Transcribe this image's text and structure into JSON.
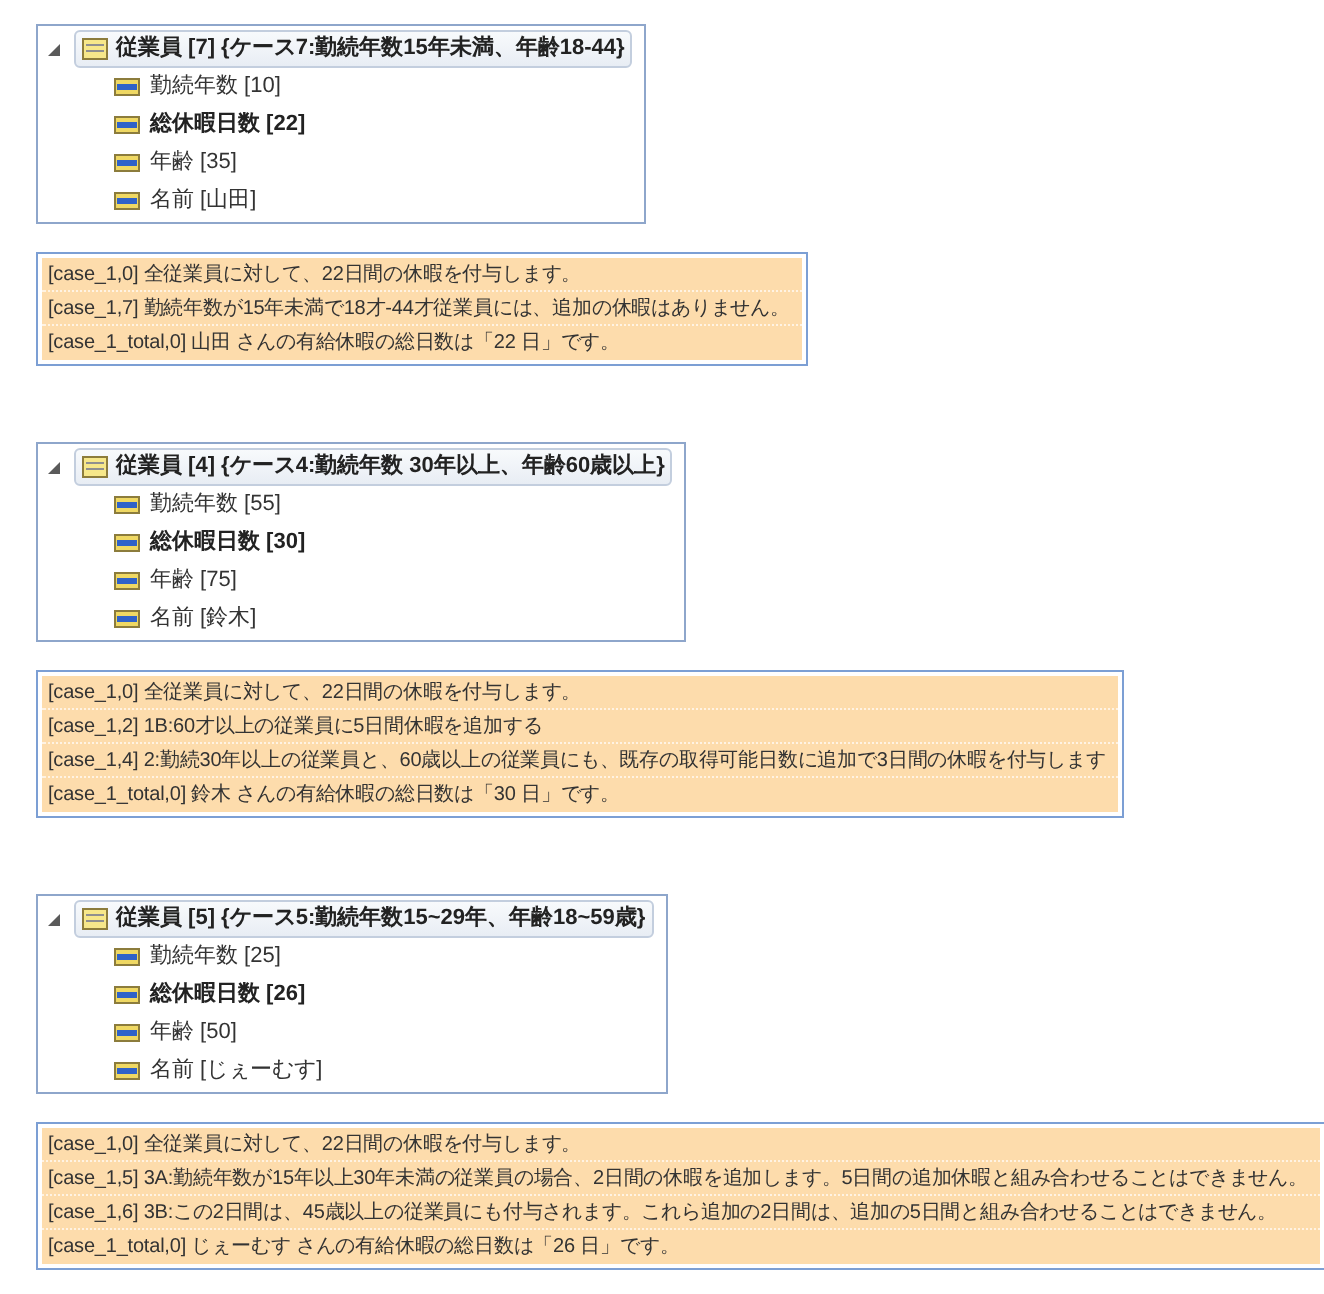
{
  "sections": [
    {
      "tree": {
        "label": "従業員 [7] {ケース7:勤続年数15年未満、年齢18-44}",
        "expanded": true,
        "selected": true,
        "children": [
          {
            "label": "勤続年数 [10]",
            "bold": false,
            "selected": false
          },
          {
            "label": "総休暇日数 [22]",
            "bold": true,
            "selected": false
          },
          {
            "label": "年齢 [35]",
            "bold": false,
            "selected": false
          },
          {
            "label": "名前 [山田]",
            "bold": false,
            "selected": false
          }
        ]
      },
      "messages": [
        "[case_1,0] 全従業員に対して、22日間の休暇を付与します。",
        "[case_1,7] 勤続年数が15年未満で18才-44才従業員には、追加の休暇はありません。",
        "[case_1_total,0] 山田 さんの有給休暇の総日数は「22 日」です。"
      ]
    },
    {
      "tree": {
        "label": "従業員 [4] {ケース4:勤続年数 30年以上、年齢60歳以上}",
        "expanded": true,
        "selected": true,
        "children": [
          {
            "label": "勤続年数 [55]",
            "bold": false,
            "selected": false
          },
          {
            "label": "総休暇日数 [30]",
            "bold": true,
            "selected": false
          },
          {
            "label": "年齢 [75]",
            "bold": false,
            "selected": false
          },
          {
            "label": "名前 [鈴木]",
            "bold": false,
            "selected": false
          }
        ]
      },
      "messages": [
        "[case_1,0] 全従業員に対して、22日間の休暇を付与します。",
        "[case_1,2] 1B:60才以上の従業員に5日間休暇を追加する",
        "[case_1,4] 2:勤続30年以上の従業員と、60歳以上の従業員にも、既存の取得可能日数に追加で3日間の休暇を付与します",
        "[case_1_total,0] 鈴木 さんの有給休暇の総日数は「30 日」です。"
      ]
    },
    {
      "tree": {
        "label": "従業員 [5] {ケース5:勤続年数15~29年、年齢18~59歳}",
        "expanded": true,
        "selected": true,
        "children": [
          {
            "label": "勤続年数 [25]",
            "bold": false,
            "selected": false
          },
          {
            "label": "総休暇日数 [26]",
            "bold": true,
            "selected": false
          },
          {
            "label": "年齢 [50]",
            "bold": false,
            "selected": false
          },
          {
            "label": "名前 [じぇーむす]",
            "bold": false,
            "selected": false
          }
        ]
      },
      "messages": [
        "[case_1,0] 全従業員に対して、22日間の休暇を付与します。",
        "[case_1,5] 3A:勤続年数が15年以上30年未満の従業員の場合、2日間の休暇を追加します。5日間の追加休暇と組み合わせることはできません。",
        "[case_1,6] 3B:この2日間は、45歳以上の従業員にも付与されます。これら追加の2日間は、追加の5日間と組み合わせることはできません。",
        "[case_1_total,0] じぇーむす さんの有給休暇の総日数は「26 日」です。"
      ]
    }
  ]
}
